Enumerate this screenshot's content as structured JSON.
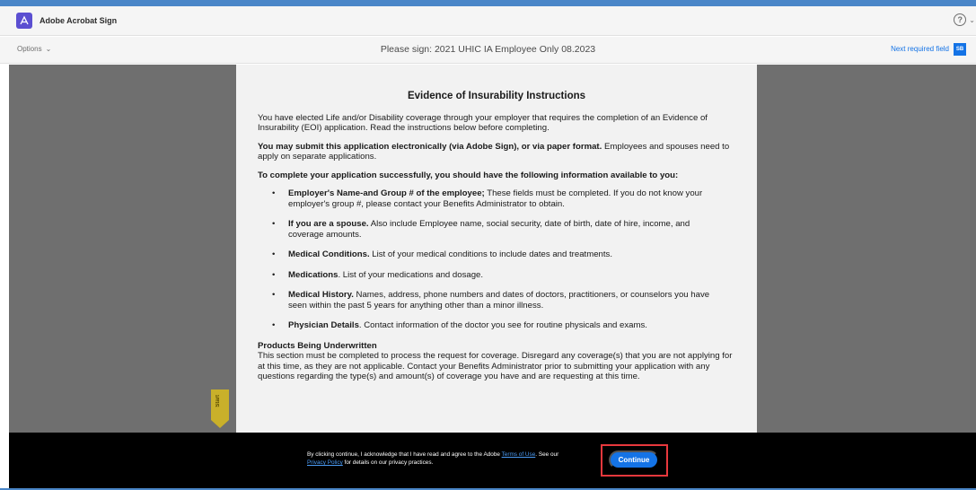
{
  "app": {
    "brand_name": "Adobe Acrobat Sign",
    "help_glyph": "?",
    "help_caret": "⌄"
  },
  "toolbar": {
    "options_label": "Options",
    "options_caret": "⌄",
    "document_title": "Please sign: 2021 UHIC IA Employee Only 08.2023",
    "next_required_label": "Next required field",
    "initials_badge": "SB"
  },
  "document": {
    "heading": "Evidence of Insurability Instructions",
    "intro": "You have elected Life and/or Disability coverage through your employer that requires the completion of an Evidence of Insurability (EOI) application. Read the instructions below before completing.",
    "submit_bold": "You may submit this application electronically (via Adobe Sign), or via paper format.",
    "submit_rest": " Employees and spouses need to apply on separate applications.",
    "info_heading": "To complete your application successfully, you should have the following information available to you:",
    "bullet_glyph": "•",
    "bullets": [
      {
        "bold": "Employer's Name-and Group # of the employee;",
        "text": " These fields must be completed. If you do not know your employer's group #, please contact your Benefits Administrator to obtain."
      },
      {
        "bold": "If you are a spouse.",
        "text": " Also include Employee name, social security, date of birth, date of hire, income, and coverage amounts."
      },
      {
        "bold": "Medical Conditions.",
        "text": " List of your medical conditions to include dates and treatments."
      },
      {
        "bold": "Medications",
        "text": ". List of your medications and dosage."
      },
      {
        "bold": "Medical History.",
        "text": " Names, address, phone numbers and dates of doctors, practitioners, or counselors you have seen within the past 5 years for anything other than a minor illness."
      },
      {
        "bold": "Physician Details",
        "text": ". Contact information of the doctor you see for routine physicals and exams."
      }
    ],
    "products_heading": "Products Being Underwritten",
    "products_text": "This section must be completed to process the request for coverage. Disregard any coverage(s) that you are not applying for at this time, as they are not applicable. Contact your Benefits Administrator prior to submitting your application with any questions regarding the type(s) and amount(s) of coverage you have and are requesting at this time."
  },
  "start_tag_label": "Start",
  "consent": {
    "text_part1": "By clicking continue, I acknowledge that I have read and agree to the Adobe ",
    "terms_link": "Terms of Use",
    "text_part2": ". See our ",
    "privacy_link": "Privacy Policy",
    "text_part3": " for details on our privacy practices.",
    "continue_label": "Continue"
  },
  "colors": {
    "accent_blue": "#1473e6",
    "brand_purple": "#5b4fd1",
    "highlight_red": "#e8383d",
    "start_tag_yellow": "#c9b02a"
  },
  "icons": {
    "brand": "adobe-acrobat-sign-logo-icon",
    "help": "help-circle-icon",
    "caret": "chevron-down-icon"
  }
}
